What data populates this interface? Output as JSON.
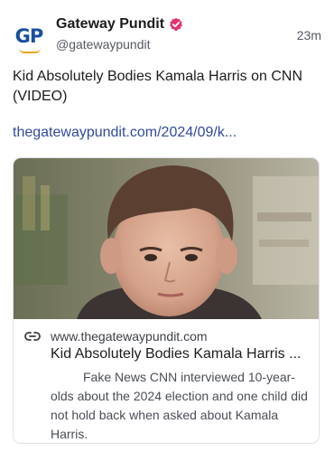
{
  "post": {
    "avatar_text": "GP",
    "display_name": "Gateway Pundit",
    "handle": "@gatewaypundit",
    "timestamp": "23m",
    "text": "Kid Absolutely Bodies Kamala Harris on CNN (VIDEO)",
    "link_text": "thegatewaypundit.com/2024/09/k..."
  },
  "card": {
    "image_icon": "child-portrait-photo",
    "domain": "www.thegatewaypundit.com",
    "title": "Kid Absolutely Bodies Kamala Harris ...",
    "description": "Fake News CNN interviewed 10-year-olds about the 2024 election and one child did not hold back when asked about Kamala Harris."
  },
  "colors": {
    "brand_blue": "#1a4f9e",
    "brand_orange": "#e8a21a",
    "verified_badge": "#e2336b",
    "link": "#2f4a9e"
  }
}
